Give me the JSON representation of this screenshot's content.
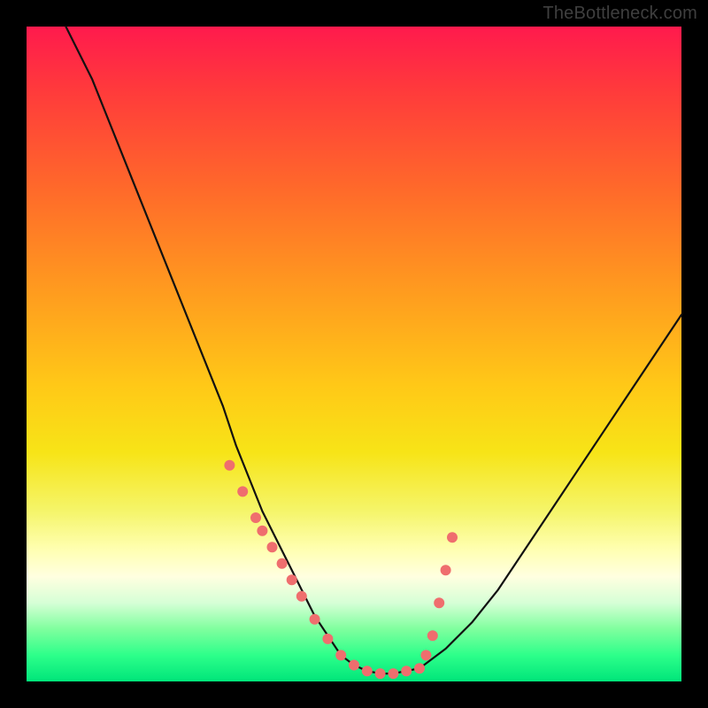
{
  "watermark": "TheBottleneck.com",
  "colors": {
    "frame": "#000000",
    "curve": "#111111",
    "marker": "#ef6e6e"
  },
  "chart_data": {
    "type": "line",
    "title": "",
    "xlabel": "",
    "ylabel": "",
    "xlim": [
      0,
      100
    ],
    "ylim": [
      0,
      100
    ],
    "grid": false,
    "legend": false,
    "series": [
      {
        "name": "bottleneck-curve",
        "x": [
          6,
          10,
          14,
          18,
          22,
          26,
          30,
          32,
          34,
          36,
          38,
          40,
          42,
          44,
          46,
          48,
          50,
          52,
          54,
          56,
          60,
          64,
          68,
          72,
          76,
          80,
          84,
          88,
          92,
          96,
          100
        ],
        "y": [
          100,
          92,
          82,
          72,
          62,
          52,
          42,
          36,
          31,
          26,
          22,
          18,
          14,
          10,
          7,
          4,
          2.5,
          1.6,
          1.2,
          1.2,
          2,
          5,
          9,
          14,
          20,
          26,
          32,
          38,
          44,
          50,
          56
        ]
      }
    ],
    "markers": {
      "name": "highlighted-points",
      "x": [
        31,
        33,
        35,
        36,
        37.5,
        39,
        40.5,
        42,
        44,
        46,
        48,
        50,
        52,
        54,
        56,
        58,
        60,
        61,
        62,
        63,
        64,
        65
      ],
      "y": [
        33,
        29,
        25,
        23,
        20.5,
        18,
        15.5,
        13,
        9.5,
        6.5,
        4,
        2.5,
        1.6,
        1.2,
        1.2,
        1.6,
        2.0,
        4,
        7,
        12,
        17,
        22
      ],
      "r": [
        6,
        6,
        6,
        6,
        6,
        6,
        6,
        6,
        6,
        6,
        6,
        6,
        6,
        6,
        6,
        6,
        6,
        6,
        6,
        6,
        6,
        6
      ]
    }
  }
}
